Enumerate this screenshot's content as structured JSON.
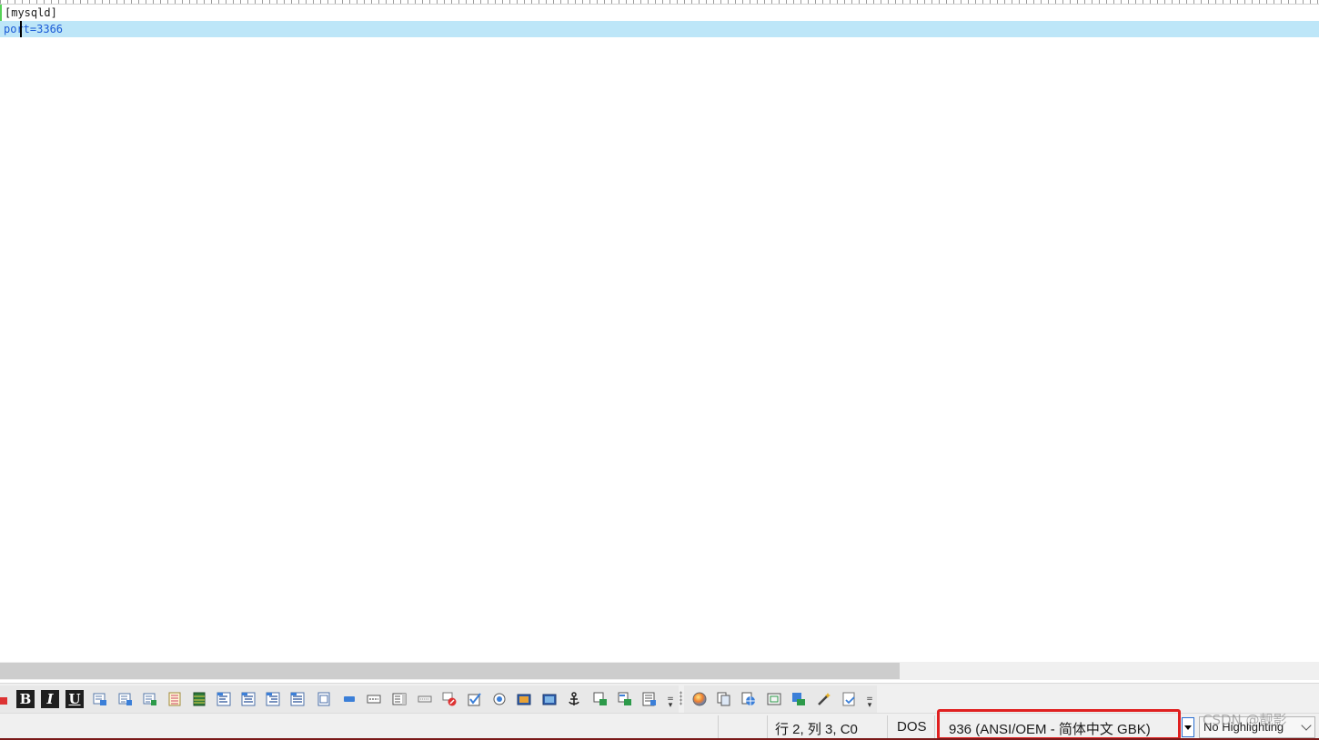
{
  "editor": {
    "lines": [
      "[mysqld]",
      "port=3366"
    ]
  },
  "toolbar": {
    "bold_label": "B",
    "italic_label": "I",
    "underline_label": "U",
    "icons": [
      "insert-link-icon",
      "insert-list-icon",
      "insert-ordered-list-icon",
      "insert-definition-list-icon",
      "table-icon",
      "color-bar-icon",
      "align-left-icon",
      "align-center-icon",
      "align-right-icon",
      "justify-icon",
      "frame-icon",
      "text-field-icon",
      "label-icon",
      "list-box-icon",
      "input-icon",
      "clear-format-icon",
      "checkbox-icon",
      "radio-icon",
      "image-icon",
      "picture-icon",
      "anchor-icon",
      "bookmark-icon",
      "convert-icon",
      "page-icon"
    ],
    "icons_group2": [
      "color-wheel-icon",
      "copy-icon",
      "globe-icon",
      "date-icon",
      "numbering-icon",
      "magic-wand-icon",
      "preview-icon"
    ]
  },
  "status": {
    "position": "行 2, 列 3, C0",
    "line_ending": "DOS",
    "encoding": "936   (ANSI/OEM - 简体中文 GBK)",
    "highlighting": "No Highlighting",
    "accent_color": "#e02020"
  },
  "watermark": "CSDN @靓影"
}
